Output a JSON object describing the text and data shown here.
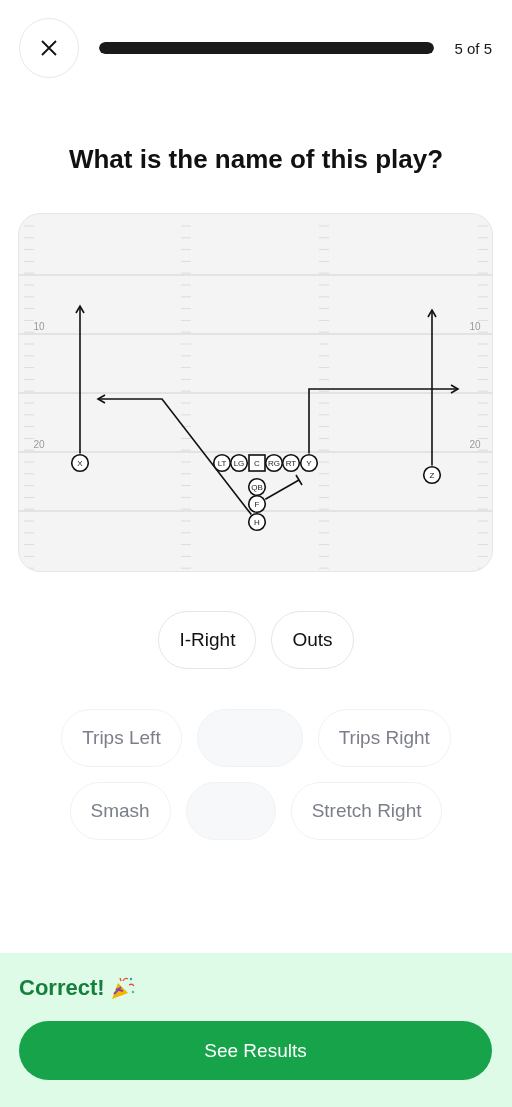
{
  "header": {
    "progress": {
      "level": 1
    },
    "counter": "5 of 5"
  },
  "question": "What is the name of this play?",
  "diagram": {
    "yard_numbers": [
      {
        "text": "10"
      },
      {
        "text": "10"
      },
      {
        "text": "20"
      },
      {
        "text": "20"
      }
    ],
    "players": [
      {
        "label": "X",
        "kind": "circle"
      },
      {
        "label": "LT",
        "kind": "circle"
      },
      {
        "label": "LG",
        "kind": "circle"
      },
      {
        "label": "C",
        "kind": "square"
      },
      {
        "label": "RG",
        "kind": "circle"
      },
      {
        "label": "RT",
        "kind": "circle"
      },
      {
        "label": "Y",
        "kind": "circle"
      },
      {
        "label": "Z",
        "kind": "circle"
      },
      {
        "label": "QB",
        "kind": "circle"
      },
      {
        "label": "F",
        "kind": "circle"
      },
      {
        "label": "H",
        "kind": "circle"
      }
    ]
  },
  "answer": [
    "I-Right",
    "Outs"
  ],
  "options": [
    [
      {
        "kind": "word",
        "label": "Trips Left"
      },
      {
        "kind": "blank"
      },
      {
        "kind": "word",
        "label": "Trips Right"
      }
    ],
    [
      {
        "kind": "word",
        "label": "Smash"
      },
      {
        "kind": "blank"
      },
      {
        "kind": "word",
        "label": "Stretch Right"
      }
    ]
  ],
  "feedback": {
    "correct": true,
    "message": "Correct!"
  },
  "continue_button": "See Results"
}
